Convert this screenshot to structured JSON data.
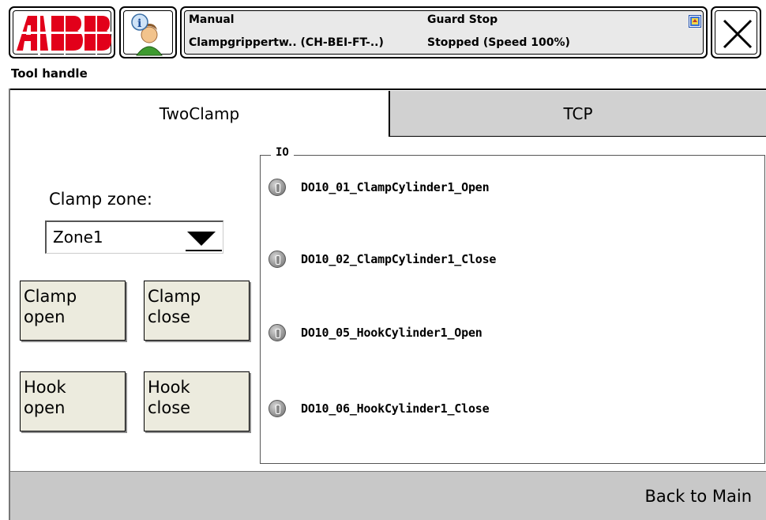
{
  "header": {
    "logo_text": "ABB",
    "mode": "Manual",
    "controller": "Clampgrippertw.. (CH-BEI-FT-..)",
    "state": "Guard Stop",
    "run_status": "Stopped (Speed 100%)",
    "info_icon": "info-user-icon",
    "close_icon": "close-x-icon",
    "brand_color": "#e2001a"
  },
  "app": {
    "title": "Tool handle"
  },
  "tabs": [
    {
      "label": "TwoClamp",
      "active": true
    },
    {
      "label": "TCP",
      "active": false
    }
  ],
  "clamp": {
    "zone_label": "Clamp zone:",
    "zone_value": "Zone1",
    "buttons": [
      {
        "line1": "Clamp",
        "line2": "open"
      },
      {
        "line1": "Clamp",
        "line2": "close"
      },
      {
        "line1": "Hook",
        "line2": "open"
      },
      {
        "line1": "Hook",
        "line2": "close"
      }
    ]
  },
  "io": {
    "title": "IO",
    "signals": [
      {
        "name": "DO10_01_ClampCylinder1_Open",
        "state": "off"
      },
      {
        "name": "DO10_02_ClampCylinder1_Close",
        "state": "off"
      },
      {
        "name": "DO10_05_HookCylinder1_Open",
        "state": "off"
      },
      {
        "name": "DO10_06_HookCylinder1_Close",
        "state": "off"
      }
    ]
  },
  "footer": {
    "back_label": "Back to Main"
  }
}
